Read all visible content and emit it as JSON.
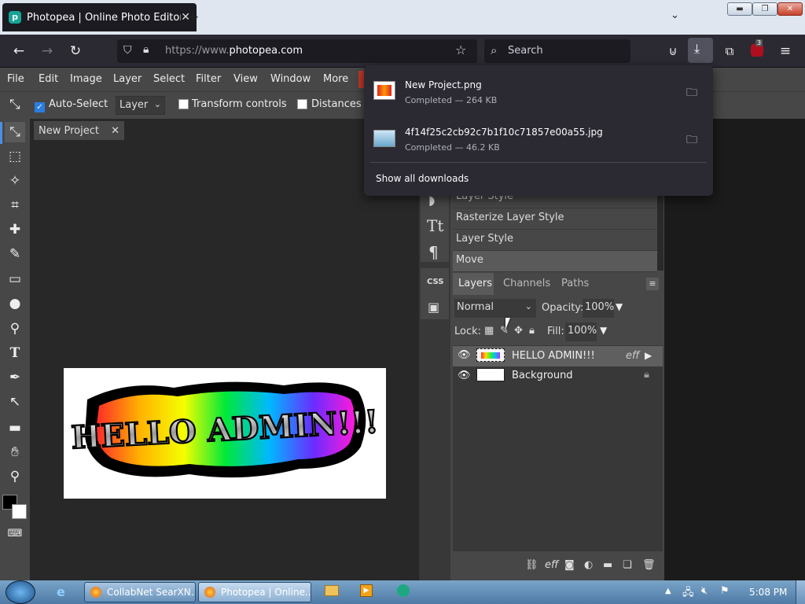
{
  "browser": {
    "tab_title": "Photopea | Online Photo Editor",
    "tab_favicon": "photopea-icon",
    "url_prefix": "https://www.",
    "url_domain": "photopea.com",
    "search_placeholder": "Search",
    "extension_badge": "3"
  },
  "downloads": {
    "items": [
      {
        "name": "New Project.png",
        "status": "Completed — 264 KB"
      },
      {
        "name": "4f14f25c2cb92c7b1f10c71857e00a55.jpg",
        "status": "Completed — 46.2 KB"
      }
    ],
    "show_all": "Show all downloads"
  },
  "menu": [
    "File",
    "Edit",
    "Image",
    "Layer",
    "Select",
    "Filter",
    "View",
    "Window",
    "More"
  ],
  "options": {
    "auto_select": "Auto-Select",
    "layer_select": "Layer",
    "transform_controls": "Transform controls",
    "distances": "Distances"
  },
  "document": {
    "tab_name": "New Project",
    "canvas_text": "HELLO ADMIN!!!"
  },
  "history": [
    "Layer Style",
    "Rasterize Layer Style",
    "Layer Style",
    "Move"
  ],
  "layers_panel": {
    "tabs": [
      "Layers",
      "Channels",
      "Paths"
    ],
    "blend_mode": "Normal",
    "opacity_label": "Opacity:",
    "opacity_value": "100%",
    "lock_label": "Lock:",
    "fill_label": "Fill:",
    "fill_value": "100%",
    "layers": [
      {
        "name": "HELLO ADMIN!!!",
        "fx": "eff"
      },
      {
        "name": "Background"
      }
    ]
  },
  "mid_strip": {
    "css_label": "CSS"
  },
  "taskbar": {
    "buttons": [
      "CollabNet SearXN...",
      "Photopea | Online..."
    ],
    "clock": "5:08 PM"
  }
}
